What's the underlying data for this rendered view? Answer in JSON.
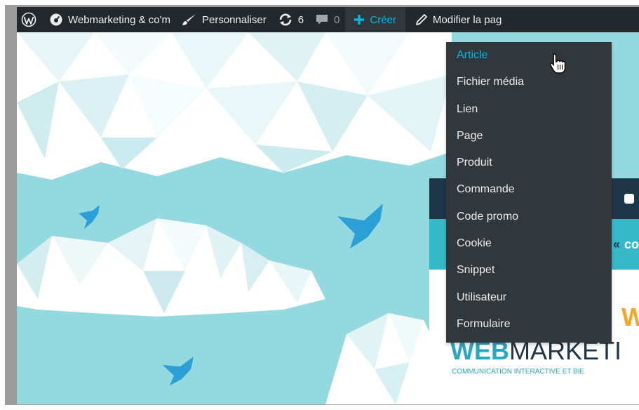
{
  "admin_bar": {
    "wp_logo_icon": "wordpress-logo-icon",
    "site_name": "Webmarketing & co'm",
    "site_icon": "dashboard-icon",
    "customize_label": "Personnaliser",
    "customize_icon": "paintbrush-icon",
    "updates_count": "6",
    "updates_icon": "update-icon",
    "comments_count": "0",
    "comments_icon": "comment-icon",
    "new_label": "Créer",
    "new_icon": "plus-icon",
    "edit_label": "Modifier la pag",
    "edit_icon": "pencil-icon"
  },
  "new_menu": {
    "items": [
      {
        "label": "Article",
        "active": true
      },
      {
        "label": "Fichier média"
      },
      {
        "label": "Lien"
      },
      {
        "label": "Page"
      },
      {
        "label": "Produit"
      },
      {
        "label": "Commande"
      },
      {
        "label": "Code promo"
      },
      {
        "label": "Cookie"
      },
      {
        "label": "Snippet"
      },
      {
        "label": "Utilisateur"
      },
      {
        "label": "Formulaire"
      }
    ]
  },
  "page": {
    "logo_text_bold": "WEB",
    "logo_text_light": "MARKETI",
    "logo_accent": "W",
    "tagline": "COMMUNICATION INTERACTIVE ET BIE",
    "social_text": "co"
  },
  "colors": {
    "admin_bar_bg": "#23282d",
    "submenu_bg": "#32373c",
    "accent_blue": "#00b9eb",
    "sky": "#93d9df",
    "site_header_dark": "#1d3649",
    "site_teal": "#36b9c9",
    "logo_teal": "#2aa7c0",
    "logo_orange": "#f6a623"
  }
}
